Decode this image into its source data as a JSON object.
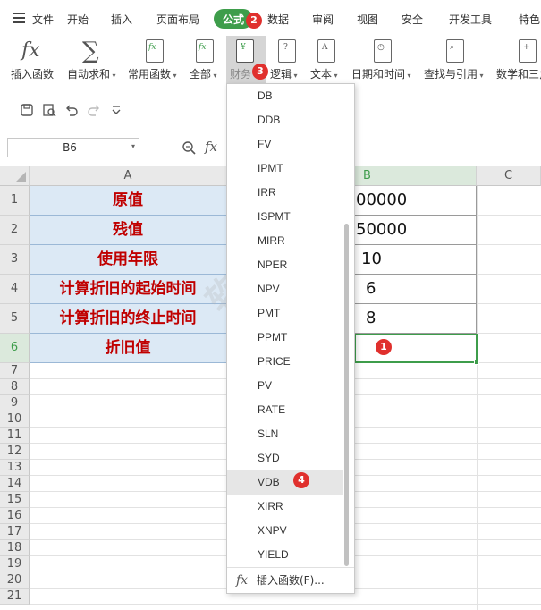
{
  "menubar": {
    "file": "文件",
    "items": [
      "开始",
      "插入",
      "页面布局",
      "公式",
      "数据",
      "审阅",
      "视图",
      "安全",
      "开发工具",
      "特色"
    ],
    "active": "公式"
  },
  "ribbon": {
    "insert_fn": "插入函数",
    "autosum": "自动求和",
    "common_fn": "常用函数",
    "all": "全部",
    "finance": "财务",
    "logic": "逻辑",
    "text": "文本",
    "datetime": "日期和时间",
    "lookup": "查找与引用",
    "math": "数学和三角"
  },
  "namebox": {
    "value": "B6"
  },
  "formula_bar": {
    "fx": "fx"
  },
  "columns": [
    "A",
    "B",
    "C"
  ],
  "rows": [
    "1",
    "2",
    "3",
    "4",
    "5",
    "6",
    "7",
    "8",
    "9",
    "10",
    "11",
    "12",
    "13",
    "14",
    "15",
    "16",
    "17",
    "18",
    "19",
    "20",
    "21"
  ],
  "cells_a": [
    "原值",
    "残值",
    "使用年限",
    "计算折旧的起始时间",
    "计算折旧的终止时间",
    "折旧值"
  ],
  "cells_b": [
    "00000",
    "50000",
    "10",
    "6",
    "8",
    ""
  ],
  "dropdown": {
    "items": [
      "DB",
      "DDB",
      "FV",
      "IPMT",
      "IRR",
      "ISPMT",
      "MIRR",
      "NPER",
      "NPV",
      "PMT",
      "PPMT",
      "PRICE",
      "PV",
      "RATE",
      "SLN",
      "SYD",
      "VDB",
      "XIRR",
      "XNPV",
      "YIELD"
    ],
    "highlighted": "VDB",
    "footer": "插入函数(F)..."
  },
  "badges": {
    "b1": "1",
    "b2": "2",
    "b3": "3",
    "b4": "4"
  },
  "watermark": {
    "main": "软件自学网",
    "url": "WWW.RJZXW.COM"
  },
  "colors": {
    "accent": "#3e9d4b",
    "badge": "#e0302d",
    "label_text": "#c00000",
    "label_bg": "#dce9f5"
  }
}
